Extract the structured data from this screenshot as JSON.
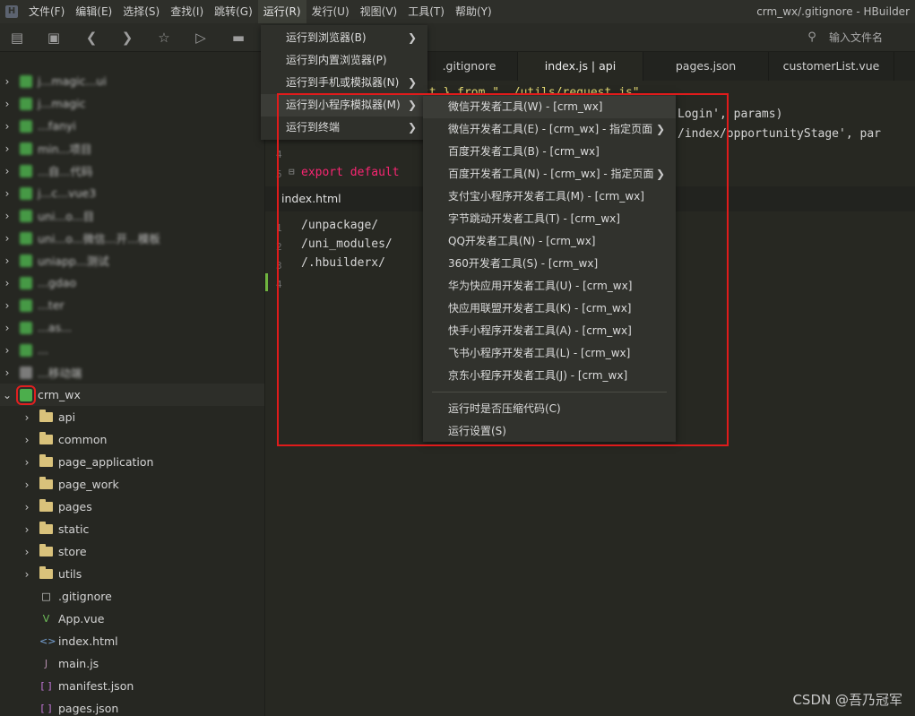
{
  "window": {
    "title": "crm_wx/.gitignore - HBuilder"
  },
  "menubar": {
    "items": [
      "文件(F)",
      "编辑(E)",
      "选择(S)",
      "查找(I)",
      "跳转(G)",
      "运行(R)",
      "发行(U)",
      "视图(V)",
      "工具(T)",
      "帮助(Y)"
    ],
    "active_index": 5
  },
  "toolbar": {
    "search_placeholder": "输入文件名"
  },
  "sidebar": {
    "projects": [
      {
        "label": "j...magic...ui"
      },
      {
        "label": "j...magic"
      },
      {
        "label": "...fanyi"
      },
      {
        "label": "min...项目"
      },
      {
        "label": "...自...代码"
      },
      {
        "label": "j...c...vue3"
      },
      {
        "label": "uni...o...目"
      },
      {
        "label": "uni...o...微信...开...模板"
      },
      {
        "label": "uniapp...测试"
      },
      {
        "label": "...gdao"
      },
      {
        "label": "...ter"
      },
      {
        "label": "...as..."
      },
      {
        "label": "..."
      },
      {
        "label": "...移动端"
      },
      {
        "label": "crm_wx"
      }
    ],
    "children": [
      {
        "label": "api",
        "type": "folder"
      },
      {
        "label": "common",
        "type": "folder"
      },
      {
        "label": "page_application",
        "type": "folder"
      },
      {
        "label": "page_work",
        "type": "folder"
      },
      {
        "label": "pages",
        "type": "folder"
      },
      {
        "label": "static",
        "type": "folder"
      },
      {
        "label": "store",
        "type": "folder"
      },
      {
        "label": "utils",
        "type": "folder"
      },
      {
        "label": ".gitignore",
        "type": "file"
      },
      {
        "label": "App.vue",
        "type": "vue"
      },
      {
        "label": "index.html",
        "type": "html"
      },
      {
        "label": "main.js",
        "type": "js"
      },
      {
        "label": "manifest.json",
        "type": "json"
      },
      {
        "label": "pages.json",
        "type": "json"
      }
    ]
  },
  "tabs": [
    {
      "label": ".gitignore"
    },
    {
      "label": "index.js | api"
    },
    {
      "label": "pages.json"
    },
    {
      "label": "customerList.vue"
    }
  ],
  "code_top": {
    "line1": "st } from \"../utils/request.js\"",
    "line2": "Login', params)",
    "line3": "/index/opportunityStage', par",
    "line5_kw": "export default",
    "line_number_4": "4",
    "line_number_5": "5"
  },
  "lower_editor": {
    "tab_label": "index.html",
    "lines": [
      "/unpackage/",
      "/uni_modules/",
      "/.hbuilderx/"
    ],
    "line_numbers": [
      "1",
      "2",
      "3",
      "4"
    ]
  },
  "run_menu": {
    "items": [
      {
        "label": "运行到浏览器(B)",
        "has_submenu": true
      },
      {
        "label": "运行到内置浏览器(P)",
        "has_submenu": false
      },
      {
        "label": "运行到手机或模拟器(N)",
        "has_submenu": true
      },
      {
        "label": "运行到小程序模拟器(M)",
        "has_submenu": true
      },
      {
        "label": "运行到终端",
        "has_submenu": true
      }
    ]
  },
  "submenu": {
    "items": [
      {
        "label": "微信开发者工具(W) - [crm_wx]",
        "has_submenu": false
      },
      {
        "label": "微信开发者工具(E) - [crm_wx] - 指定页面",
        "has_submenu": true
      },
      {
        "label": "百度开发者工具(B) - [crm_wx]",
        "has_submenu": false
      },
      {
        "label": "百度开发者工具(N) - [crm_wx] - 指定页面",
        "has_submenu": true
      },
      {
        "label": "支付宝小程序开发者工具(M) - [crm_wx]",
        "has_submenu": false
      },
      {
        "label": "字节跳动开发者工具(T) - [crm_wx]",
        "has_submenu": false
      },
      {
        "label": "QQ开发者工具(N) - [crm_wx]",
        "has_submenu": false
      },
      {
        "label": "360开发者工具(S) - [crm_wx]",
        "has_submenu": false
      },
      {
        "label": "华为快应用开发者工具(U) - [crm_wx]",
        "has_submenu": false
      },
      {
        "label": "快应用联盟开发者工具(K) - [crm_wx]",
        "has_submenu": false
      },
      {
        "label": "快手小程序开发者工具(A) - [crm_wx]",
        "has_submenu": false
      },
      {
        "label": "飞书小程序开发者工具(L) - [crm_wx]",
        "has_submenu": false
      },
      {
        "label": "京东小程序开发者工具(J) - [crm_wx]",
        "has_submenu": false
      }
    ],
    "footer_items": [
      {
        "label": "运行时是否压缩代码(C)"
      },
      {
        "label": "运行设置(S)"
      }
    ]
  },
  "watermark": "CSDN @吾乃冠军",
  "colors": {
    "highlight": "#e01b1b",
    "project_icon": "#4cae4c",
    "folder": "#d9c27b"
  }
}
